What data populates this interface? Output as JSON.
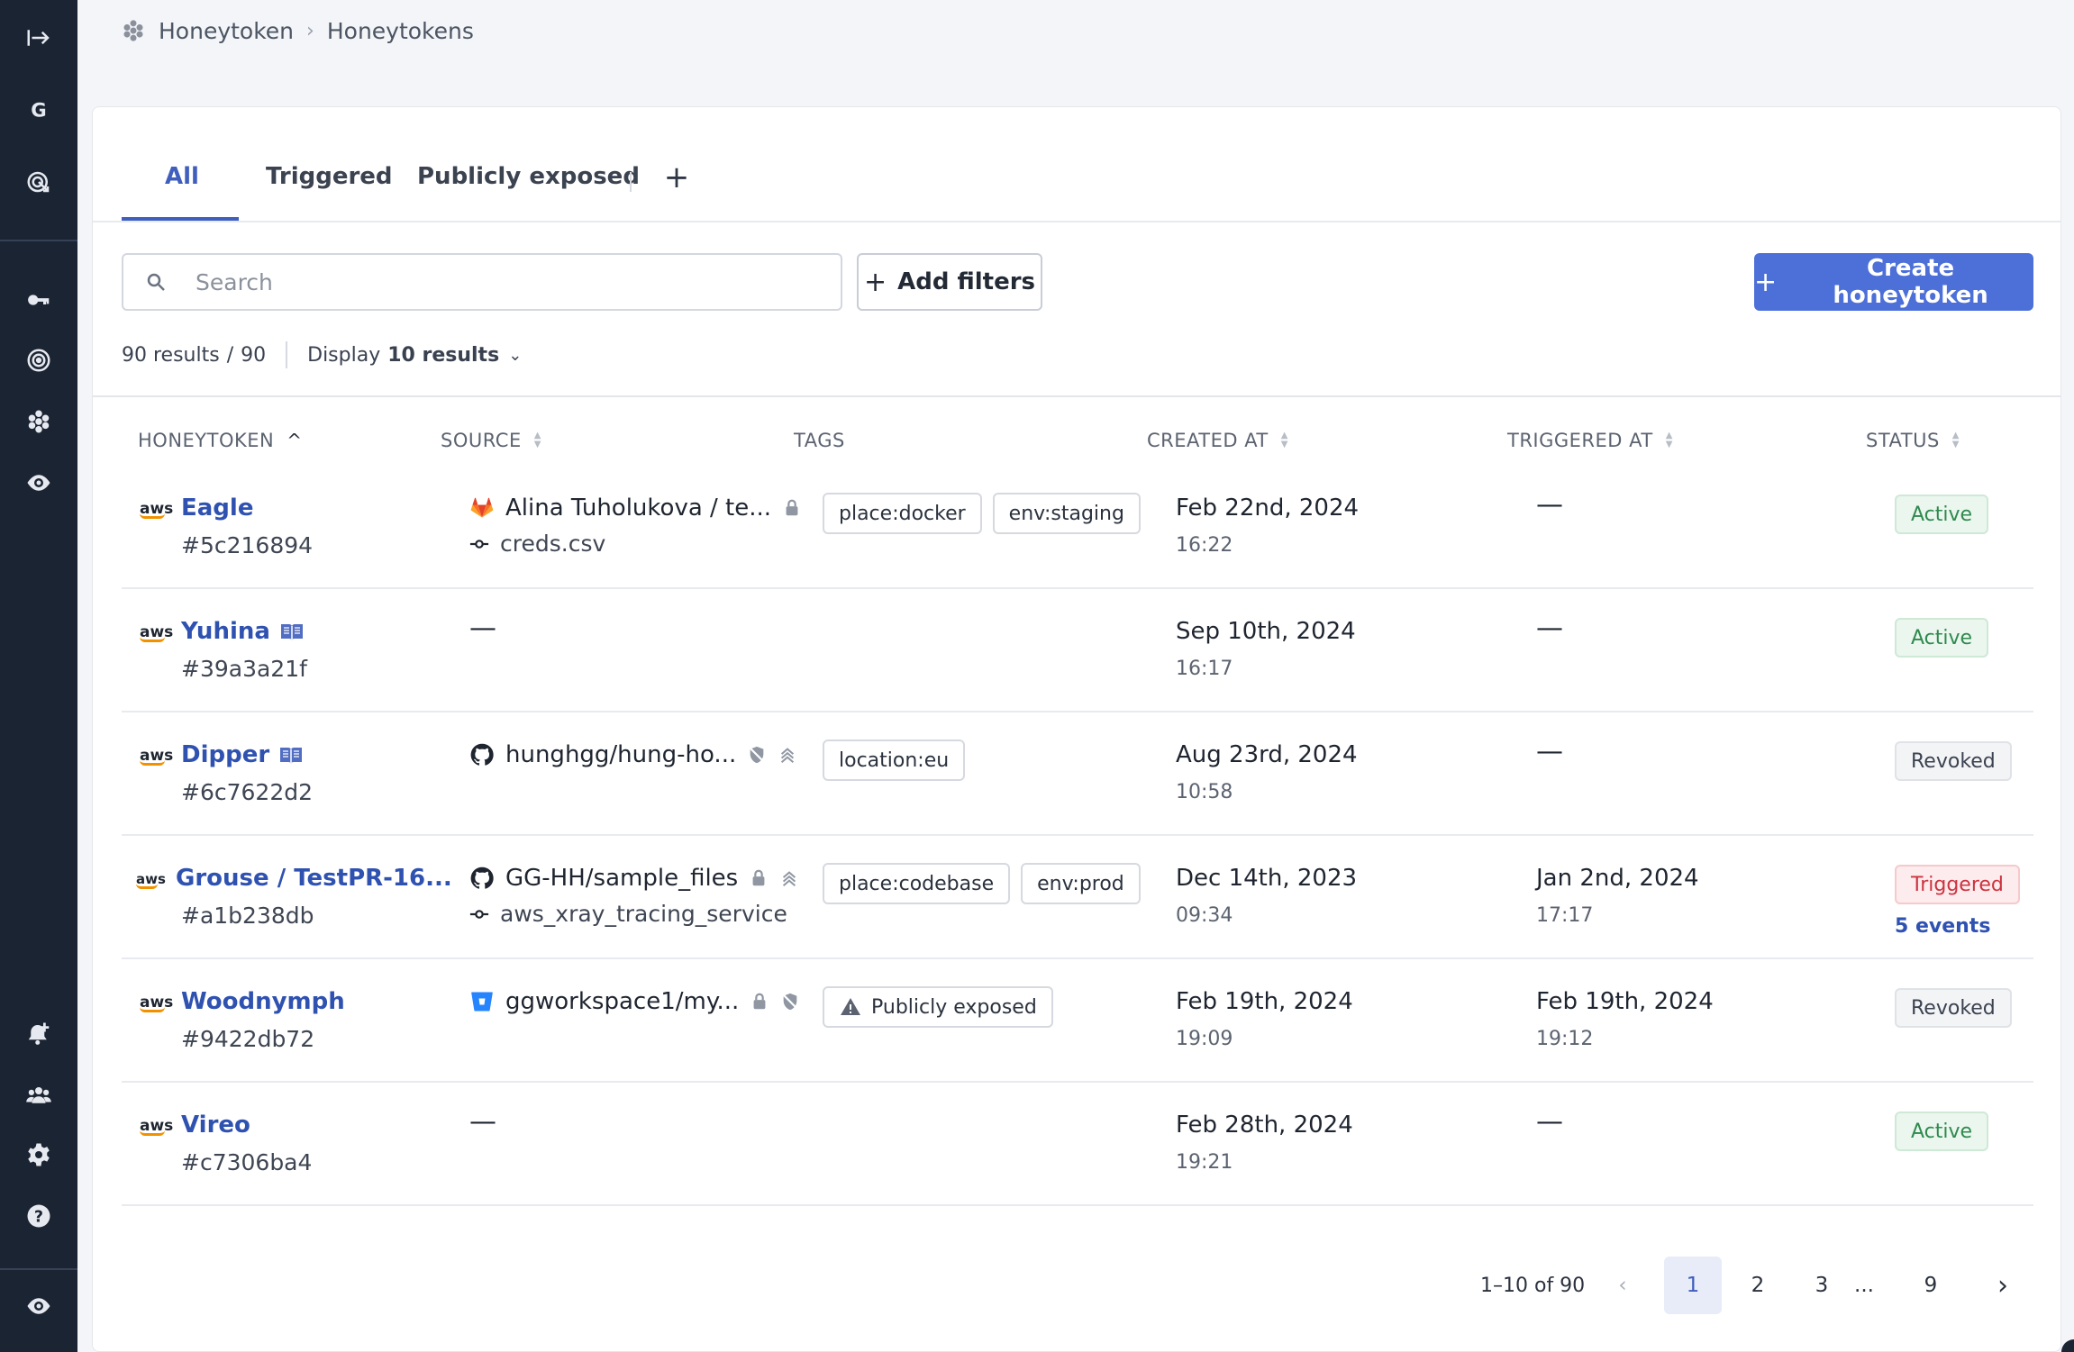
{
  "breadcrumb": {
    "root": "Honeytoken",
    "current": "Honeytokens"
  },
  "tabs": [
    {
      "label": "All",
      "active": true
    },
    {
      "label": "Triggered",
      "active": false
    },
    {
      "label": "Publicly exposed",
      "active": false
    }
  ],
  "tab_add": "+",
  "search": {
    "placeholder": "Search",
    "value": ""
  },
  "toolbar": {
    "add_filters": "Add filters",
    "create": "Create honeytoken"
  },
  "results": {
    "count": "90 results",
    "slash": "/",
    "total": "90",
    "display_label": "Display",
    "display_value": "10 results"
  },
  "columns": {
    "honeytoken": "HONEYTOKEN",
    "source": "SOURCE",
    "tags": "TAGS",
    "created_at": "CREATED AT",
    "triggered_at": "TRIGGERED AT",
    "status": "STATUS"
  },
  "rows": [
    {
      "provider": "aws",
      "name": "Eagle",
      "id": "#5c216894",
      "source": "Alina Tuholukova / te...",
      "source_sub": "creds.csv",
      "tags": [
        "place:docker",
        "env:staging"
      ],
      "created_date": "Feb 22nd, 2024",
      "created_time": "16:22",
      "triggered": "—",
      "status": "Active"
    },
    {
      "provider": "aws",
      "name": "Yuhina",
      "id": "#39a3a21f",
      "source": "—",
      "tags": [],
      "created_date": "Sep 10th, 2024",
      "created_time": "16:17",
      "triggered": "—",
      "status": "Active"
    },
    {
      "provider": "aws",
      "name": "Dipper",
      "id": "#6c7622d2",
      "source": "hunghgg/hung-ho...",
      "tags": [
        "location:eu"
      ],
      "created_date": "Aug 23rd, 2024",
      "created_time": "10:58",
      "triggered": "—",
      "status": "Revoked"
    },
    {
      "provider": "aws",
      "name": "Grouse / TestPR-16...",
      "id": "#a1b238db",
      "source": "GG-HH/sample_files",
      "source_sub": "aws_xray_tracing_service",
      "tags": [
        "place:codebase",
        "env:prod"
      ],
      "created_date": "Dec 14th, 2023",
      "created_time": "09:34",
      "triggered_date": "Jan 2nd, 2024",
      "triggered_time": "17:17",
      "status": "Triggered",
      "events": "5 events"
    },
    {
      "provider": "aws",
      "name": "Woodnymph",
      "id": "#9422db72",
      "source": "ggworkspace1/my...",
      "tags": [
        "Publicly exposed"
      ],
      "created_date": "Feb 19th, 2024",
      "created_time": "19:09",
      "triggered_date": "Feb 19th, 2024",
      "triggered_time": "19:12",
      "status": "Revoked"
    },
    {
      "provider": "aws",
      "name": "Vireo",
      "id": "#c7306ba4",
      "source": "—",
      "tags": [],
      "created_date": "Feb 28th, 2024",
      "created_time": "19:21",
      "triggered": "—",
      "status": "Active"
    }
  ],
  "pagination": {
    "range": "1–10 of 90",
    "pages": [
      "1",
      "2",
      "3",
      "...",
      "9"
    ],
    "current": "1"
  },
  "colors": {
    "sidebar": "#1b2433",
    "accent": "#4c6fd8",
    "link": "#2f52b1",
    "active": "#2f8a4e",
    "triggered": "#cc3340"
  },
  "icons": {
    "sidebar_top": [
      "expand-icon",
      "workspace-g-icon",
      "radar-icon"
    ],
    "sidebar_mid": [
      "key-icon",
      "target-icon",
      "honeytoken-icon",
      "eye-icon"
    ],
    "sidebar_bottom": [
      "bell-plus-icon",
      "team-icon",
      "gear-icon",
      "help-icon",
      "eye-icon"
    ]
  }
}
